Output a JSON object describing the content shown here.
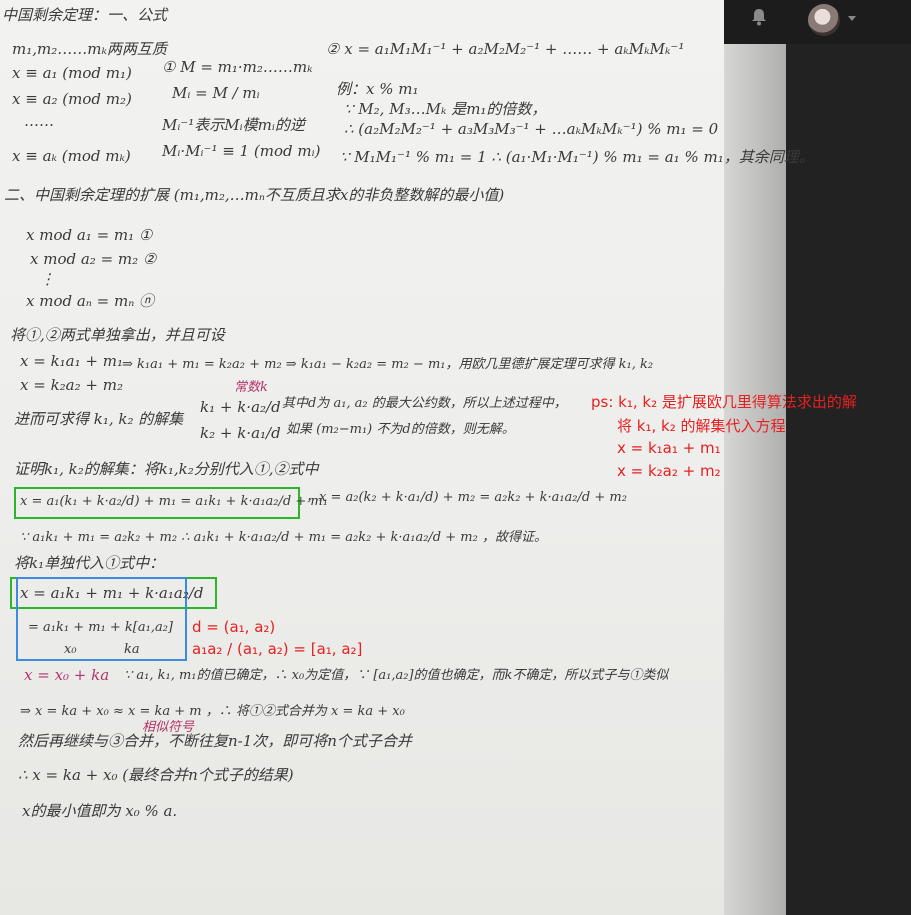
{
  "header": {
    "bell_icon": "bell-icon",
    "avatar_icon": "avatar",
    "menu_icon": "chevron-down-icon"
  },
  "note": {
    "title": "中国剩余定理：一、公式",
    "line_coprime": "m₁,m₂……mₖ两两互质",
    "sys1": "x ≡ a₁ (mod m₁)",
    "sys2": "x ≡ a₂ (mod m₂)",
    "sys_dots": "……",
    "sysk": "x ≡ aₖ (mod mₖ)",
    "p1_a": "① M = m₁·m₂……mₖ",
    "p1_b": "Mᵢ = M / mᵢ",
    "p1_c": "Mᵢ⁻¹表示Mᵢ模mᵢ的逆",
    "p1_d": "Mᵢ·Mᵢ⁻¹ ≡ 1 (mod mᵢ)",
    "p2_a": "② x = a₁M₁M₁⁻¹ + a₂M₂M₂⁻¹ + …… + aₖMₖMₖ⁻¹",
    "p2_b": "例：x % m₁",
    "p2_c": "∵ M₂, M₃…Mₖ 是m₁的倍数，",
    "p2_d": "∴ (a₂M₂M₂⁻¹ + a₃M₃M₃⁻¹ + …aₖMₖMₖ⁻¹) % m₁ = 0",
    "p2_e": "∵ M₁M₁⁻¹ % m₁ = 1  ∴ (a₁·M₁·M₁⁻¹) % m₁ = a₁ % m₁，其余同理。",
    "sec2_title": "二、中国剩余定理的扩展 (m₁,m₂,…mₙ不互质且求x的非负整数解的最小值)",
    "ext1": "x mod a₁ = m₁ ①",
    "ext2": "x mod a₂ = m₂ ②",
    "ext_dots": "⋮",
    "extn": "x mod aₙ = mₙ ⓝ",
    "take": "将①,②两式单独拿出，并且可设",
    "t1": "x = k₁a₁ + m₁",
    "t2": "x = k₂a₂ + m₂",
    "t3": "⇒ k₁a₁ + m₁ = k₂a₂ + m₂ ⇒ k₁a₁ − k₂a₂ = m₂ − m₁，用欧几里德扩展定理可求得 k₁, k₂",
    "t4": "进而可求得 k₁, k₂ 的解集",
    "t5a": "k₁ + k·a₂/d",
    "t5b": "k₂ + k·a₁/d",
    "t5_const": "常数k",
    "t6": "其中d为 a₁, a₂ 的最大公约数，所以上述过程中，",
    "t7": "如果 (m₂−m₁) 不为d的倍数，则无解。",
    "proof": "证明k₁, k₂的解集：将k₁,k₂分别代入①,②式中",
    "eq1": "x = a₁(k₁ + k·a₂/d) + m₁ = a₁k₁ + k·a₁a₂/d + m₁",
    "eq2": "，x = a₂(k₂ + k·a₁/d) + m₂ = a₂k₂ + k·a₁a₂/d + m₂",
    "eq3": "∵ a₁k₁ + m₁ = a₂k₂ + m₂  ∴ a₁k₁ + k·a₁a₂/d + m₁ = a₂k₂ + k·a₁a₂/d + m₂ ，故得证。",
    "sub": "将k₁单独代入①式中：",
    "eq4": "x = a₁k₁ + m₁ + k·a₁a₂/d",
    "eq5a": "= a₁k₁ + m₁ + k[a₁,a₂]",
    "eq5_x0": "x₀",
    "eq5_ka": "ka",
    "eq6": "x = x₀ + ka",
    "eq6_note": "∵ a₁, k₁, m₁的值已确定，∴ x₀为定值，∵ [a₁,a₂]的值也确定，而k不确定，所以式子与①类似",
    "eq7": "⇒ x = ka + x₀  ≈  x = ka + m ，∴ 将①②式合并为 x = ka + x₀",
    "eq7_note": "相似符号",
    "eq8": "然后再继续与③合并，不断往复n-1次，即可将n个式子合并",
    "eq9": "∴ x = ka + x₀ (最终合并n个式子的结果)",
    "eq10": "x的最小值即为 x₀ % a."
  },
  "annotations": {
    "ps_line1": "ps: k₁, k₂ 是扩展欧几里得算法求出的解",
    "ps_line2": "将 k₁, k₂ 的解集代入方程",
    "ps_line3": "x = k₁a₁ + m₁",
    "ps_line4": "x =  k₂a₂ + m₂",
    "d_def": "d = (a₁, a₂)",
    "lcm_def": "a₁a₂ / (a₁, a₂) = [a₁, a₂]"
  },
  "colors": {
    "ink": "#3a3a3a",
    "red_annotation": "#e62020",
    "pink_annotation": "#b2356a",
    "green_box": "#2ab52a",
    "blue_box": "#3d8be0"
  }
}
